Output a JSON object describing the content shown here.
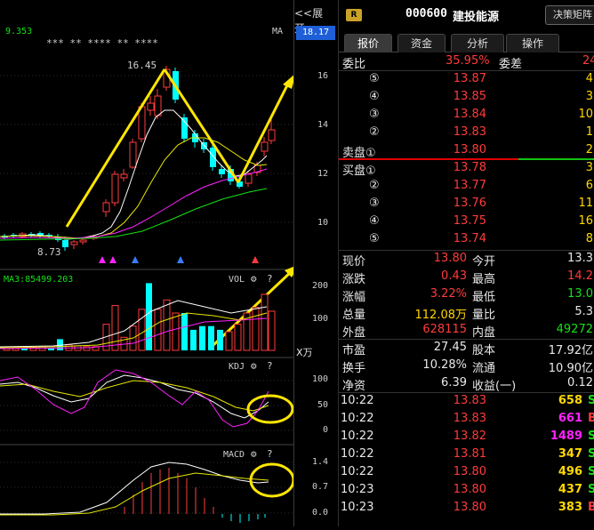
{
  "chart": {
    "ma_label": "MA",
    "ma_value": "9.353",
    "star_marks": "*** ** **** ** ****",
    "high_label": "16.45",
    "low_label": "8.73",
    "vol_label": "VOL",
    "vol_ma_text": "MA3:85499.203",
    "kdj_label": "KDJ",
    "macd_label": "MACD",
    "question": "?"
  },
  "axis": {
    "expand": "<<展开",
    "current_price": "18.17",
    "price_ticks": [
      "16",
      "14",
      "12",
      "10"
    ],
    "vol_ticks": [
      "200",
      "100"
    ],
    "vol_unit": "X万",
    "kdj_ticks": [
      "100",
      "50",
      "0"
    ],
    "macd_ticks": [
      "1.4",
      "0.7",
      "0.0"
    ]
  },
  "header": {
    "badge": "R",
    "code": "000600",
    "name": "建投能源",
    "decision_button": "决策矩阵"
  },
  "tabs": [
    "报价",
    "资金",
    "分析",
    "操作"
  ],
  "order_book": {
    "ratio_label": "委比",
    "ratio_value": "35.95%",
    "diff_label": "委差",
    "diff_value": "24",
    "sells": [
      {
        "level": "⑤",
        "price": "13.87",
        "vol": "4"
      },
      {
        "level": "④",
        "price": "13.85",
        "vol": "3"
      },
      {
        "level": "③",
        "price": "13.84",
        "vol": "10"
      },
      {
        "level": "②",
        "price": "13.83",
        "vol": "1"
      },
      {
        "level": "卖盘①",
        "price": "13.80",
        "vol": "2"
      }
    ],
    "buys": [
      {
        "level": "买盘①",
        "price": "13.78",
        "vol": "3"
      },
      {
        "level": "②",
        "price": "13.77",
        "vol": "6"
      },
      {
        "level": "③",
        "price": "13.76",
        "vol": "11"
      },
      {
        "level": "④",
        "price": "13.75",
        "vol": "16"
      },
      {
        "level": "⑤",
        "price": "13.74",
        "vol": "8"
      }
    ]
  },
  "quote": [
    {
      "l1": "现价",
      "v1": "13.80",
      "c1": "red",
      "l2": "今开",
      "v2": "13.3",
      "c2": "white"
    },
    {
      "l1": "涨跌",
      "v1": "0.43",
      "c1": "red",
      "l2": "最高",
      "v2": "14.2",
      "c2": "red"
    },
    {
      "l1": "涨幅",
      "v1": "3.22%",
      "c1": "red",
      "l2": "最低",
      "v2": "13.0",
      "c2": "green"
    },
    {
      "l1": "总量",
      "v1": "112.08万",
      "c1": "yellow",
      "l2": "量比",
      "v2": "5.3",
      "c2": "white"
    },
    {
      "l1": "外盘",
      "v1": "628115",
      "c1": "red",
      "l2": "内盘",
      "v2": "49272",
      "c2": "green"
    }
  ],
  "fundamentals": [
    {
      "l1": "市盈",
      "v1": "27.45",
      "l2": "股本",
      "v2": "17.92亿"
    },
    {
      "l1": "换手",
      "v1": "10.28%",
      "l2": "流通",
      "v2": "10.90亿"
    },
    {
      "l1": "净资",
      "v1": "6.39",
      "l2": "收益(一)",
      "v2": "0.12"
    }
  ],
  "ticks": [
    {
      "time": "10:22",
      "price": "13.83",
      "vol": "658",
      "vc": "yellow",
      "dir": "S",
      "dc": "green"
    },
    {
      "time": "10:22",
      "price": "13.83",
      "vol": "661",
      "vc": "magenta",
      "dir": "B",
      "dc": "red"
    },
    {
      "time": "10:22",
      "price": "13.82",
      "vol": "1489",
      "vc": "magenta",
      "dir": "S",
      "dc": "green"
    },
    {
      "time": "10:22",
      "price": "13.81",
      "vol": "347",
      "vc": "yellow",
      "dir": "S",
      "dc": "green"
    },
    {
      "time": "10:22",
      "price": "13.80",
      "vol": "496",
      "vc": "yellow",
      "dir": "S",
      "dc": "green"
    },
    {
      "time": "10:23",
      "price": "13.80",
      "vol": "437",
      "vc": "yellow",
      "dir": "S",
      "dc": "green"
    },
    {
      "time": "10:23",
      "price": "13.80",
      "vol": "383",
      "vc": "yellow",
      "dir": "B",
      "dc": "red"
    }
  ]
}
